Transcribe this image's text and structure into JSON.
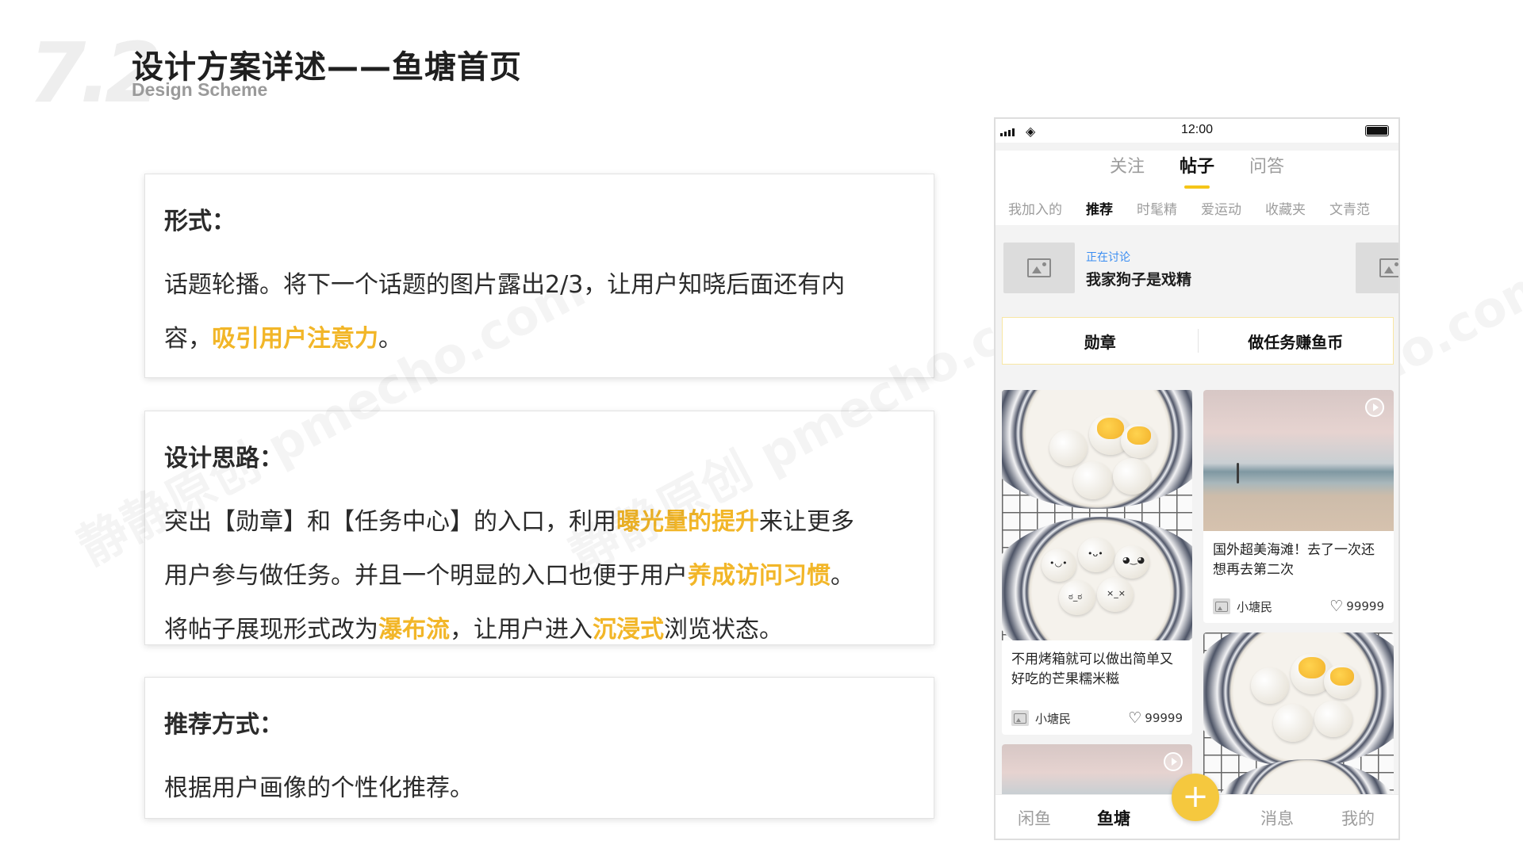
{
  "header": {
    "section_number": "7.2",
    "title": "设计方案详述——鱼塘首页",
    "subtitle": "Design Scheme"
  },
  "watermark": "静静原创 pmecho.com",
  "cards": [
    {
      "heading": "形式：",
      "lines": [
        [
          {
            "t": "话题轮播。将下一个话题的图片露出2/3，让用户知晓后面还有内"
          }
        ],
        [
          {
            "t": "容，"
          },
          {
            "t": "吸引用户注意力",
            "hl": true
          },
          {
            "t": "。"
          }
        ]
      ]
    },
    {
      "heading": "设计思路：",
      "lines": [
        [
          {
            "t": "突出【勋章】和【任务中心】的入口，利用"
          },
          {
            "t": "曝光量的提升",
            "hl": true
          },
          {
            "t": "来让更多"
          }
        ],
        [
          {
            "t": "用户参与做任务。并且一个明显的入口也便于用户"
          },
          {
            "t": "养成访问习惯",
            "hl": true
          },
          {
            "t": "。"
          }
        ],
        [
          {
            "t": "将帖子展现形式改为"
          },
          {
            "t": "瀑布流",
            "hl": true
          },
          {
            "t": "，让用户进入"
          },
          {
            "t": "沉浸式",
            "hl": true
          },
          {
            "t": "浏览状态。"
          }
        ]
      ]
    },
    {
      "heading": "推荐方式：",
      "lines": [
        [
          {
            "t": "根据用户画像的个性化推荐。"
          }
        ]
      ]
    }
  ],
  "colors": {
    "highlight": "#f2b628",
    "accent_yellow": "#f5c518",
    "topic_blue": "#3a8df2"
  },
  "phone": {
    "status": {
      "time": "12:00",
      "icons": [
        "signal-icon",
        "wifi-icon",
        "battery-icon"
      ]
    },
    "main_tabs": [
      {
        "label": "关注",
        "active": false
      },
      {
        "label": "帖子",
        "active": true
      },
      {
        "label": "问答",
        "active": false
      }
    ],
    "sub_tabs": [
      {
        "label": "我加入的",
        "active": false
      },
      {
        "label": "推荐",
        "active": true
      },
      {
        "label": "时髦精",
        "active": false
      },
      {
        "label": "爱运动",
        "active": false
      },
      {
        "label": "收藏夹",
        "active": false
      },
      {
        "label": "文青范",
        "active": false
      }
    ],
    "topic": {
      "label": "正在讨论",
      "title": "我家狗子是戏精"
    },
    "entries": {
      "badge": "勋章",
      "task": "做任务赚鱼币"
    },
    "posts": [
      {
        "title": "不用烤箱就可以做出简单又好吃的芒果糯米糍",
        "author": "小塘民",
        "likes": "99999"
      },
      {
        "title": "国外超美海滩！去了一次还想再去第二次",
        "author": "小塘民",
        "likes": "99999"
      }
    ],
    "bottom_nav": [
      {
        "label": "闲鱼",
        "active": false
      },
      {
        "label": "鱼塘",
        "active": true
      },
      {
        "label": "消息",
        "active": false
      },
      {
        "label": "我的",
        "active": false
      }
    ],
    "fab_label": "+"
  }
}
